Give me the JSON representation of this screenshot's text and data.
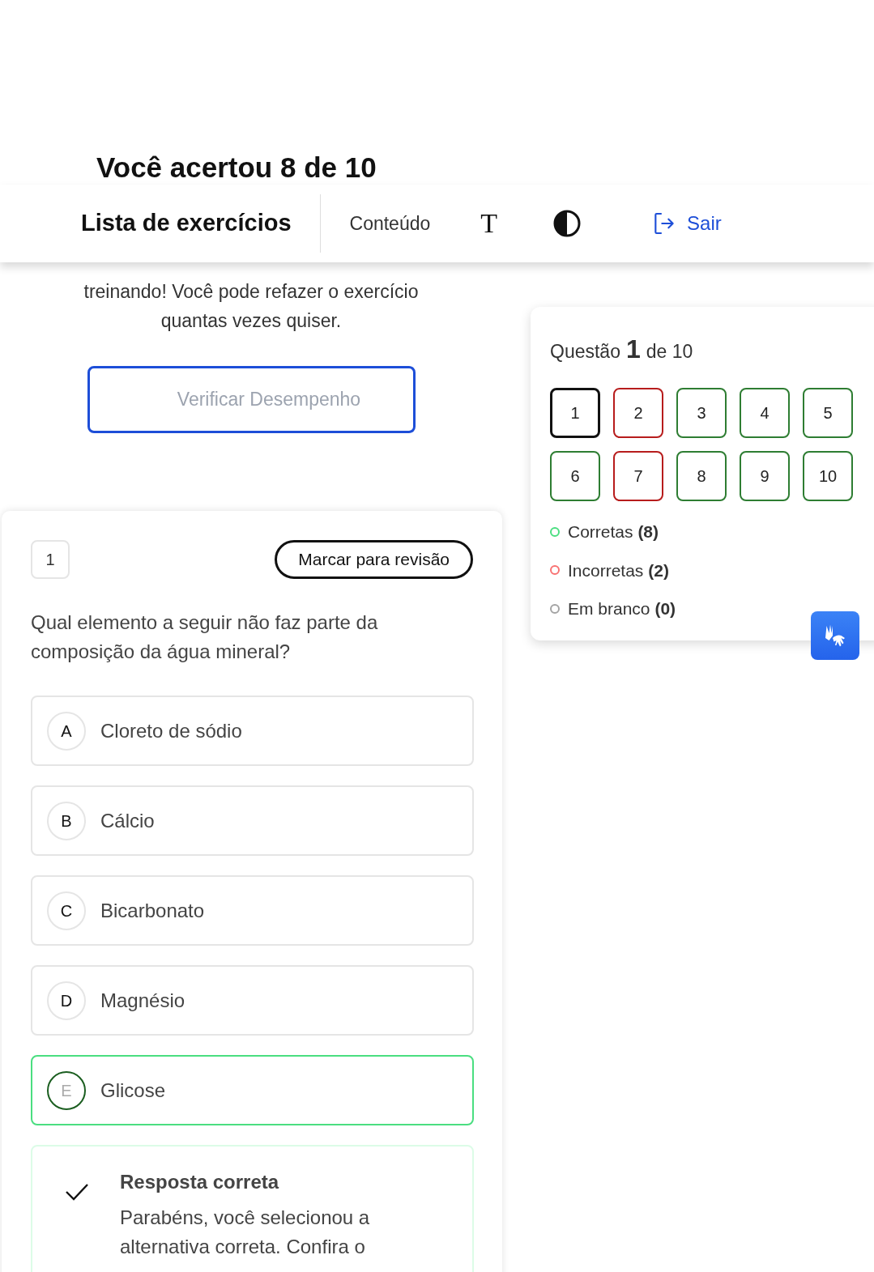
{
  "result_title": "Você acertou 8 de 10",
  "header": {
    "title": "Lista de exercícios",
    "content_link": "Conteúdo",
    "font_toggle": "T",
    "logout": "Sair"
  },
  "summary": {
    "text": "treinando! Você pode refazer o exercício quantas vezes quiser.",
    "button": "Verificar Desempenho"
  },
  "question": {
    "number": "1",
    "review_button": "Marcar para revisão",
    "text": "Qual elemento a seguir não faz parte da composição da água mineral?",
    "options": [
      {
        "letter": "A",
        "text": "Cloreto de sódio",
        "selected": false
      },
      {
        "letter": "B",
        "text": "Cálcio",
        "selected": false
      },
      {
        "letter": "C",
        "text": "Bicarbonato",
        "selected": false
      },
      {
        "letter": "D",
        "text": "Magnésio",
        "selected": false
      },
      {
        "letter": "E",
        "text": "Glicose",
        "selected": true
      }
    ],
    "feedback": {
      "title": "Resposta correta",
      "text": "Parabéns, você selecionou a alternativa correta. Confira o"
    }
  },
  "navigator": {
    "label": "Questão",
    "current": "1",
    "total": "de 10",
    "questions": [
      {
        "number": "1",
        "color": "#111111",
        "selected": true
      },
      {
        "number": "2",
        "color": "#b71c1c",
        "selected": false
      },
      {
        "number": "3",
        "color": "#2e7d32",
        "selected": false
      },
      {
        "number": "4",
        "color": "#2e7d32",
        "selected": false
      },
      {
        "number": "5",
        "color": "#2e7d32",
        "selected": false
      },
      {
        "number": "6",
        "color": "#2e7d32",
        "selected": false
      },
      {
        "number": "7",
        "color": "#b71c1c",
        "selected": false
      },
      {
        "number": "8",
        "color": "#2e7d32",
        "selected": false
      },
      {
        "number": "9",
        "color": "#2e7d32",
        "selected": false
      },
      {
        "number": "10",
        "color": "#2e7d32",
        "selected": false
      }
    ],
    "legend": [
      {
        "label": "Corretas",
        "count": "(8)",
        "color": "#4ade80"
      },
      {
        "label": "Incorretas",
        "count": "(2)",
        "color": "#f87171"
      },
      {
        "label": "Em branco",
        "count": "(0)",
        "color": "#a3a3a3"
      }
    ]
  }
}
